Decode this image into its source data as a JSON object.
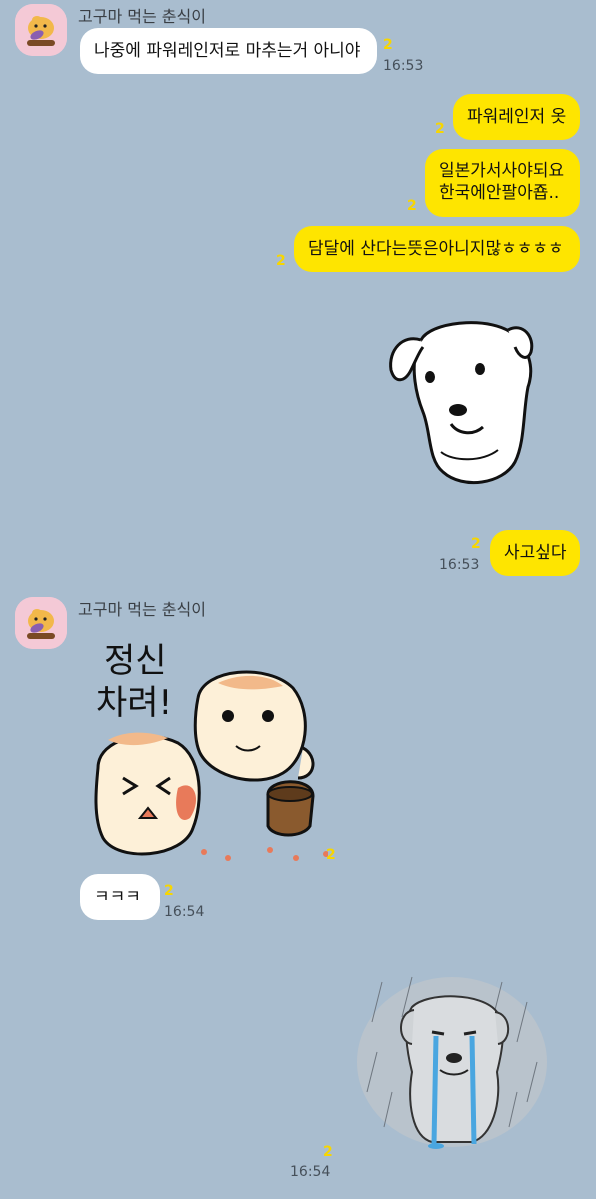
{
  "chat": {
    "sender_name": "고구마 먹는 춘식이",
    "messages": [
      {
        "id": "m1",
        "direction": "in",
        "text": "나중에 파워레인저로 마추는거 아니야",
        "unread": "2",
        "time": "16:53"
      },
      {
        "id": "m2",
        "direction": "out",
        "text": "파워레인저 옷",
        "unread": "2"
      },
      {
        "id": "m3",
        "direction": "out",
        "lines": [
          "일본가서사야되요",
          "한국에안팔아죱.."
        ],
        "unread": "2"
      },
      {
        "id": "m4",
        "direction": "out",
        "text": "담달에 산다는뜻은아니지많ㅎㅎㅎㅎ",
        "unread": "2"
      },
      {
        "id": "m5",
        "direction": "out",
        "type": "sticker",
        "sticker": "white-dog-sticker"
      },
      {
        "id": "m6",
        "direction": "out",
        "text": "사고싶다",
        "unread": "2",
        "time": "16:53"
      },
      {
        "id": "m7",
        "direction": "in",
        "type": "sticker",
        "sticker": "hamsters-sticker",
        "sticker_text": [
          "정신",
          "차려!"
        ],
        "unread": "2"
      },
      {
        "id": "m8",
        "direction": "in",
        "text": "ㅋㅋㅋ",
        "unread": "2",
        "time": "16:54"
      },
      {
        "id": "m9",
        "direction": "out",
        "type": "sticker",
        "sticker": "crying-dog-rain-sticker",
        "unread": "2",
        "time": "16:54"
      }
    ]
  },
  "colors": {
    "background": "#a9bdcf",
    "outgoing_bubble": "#fee500",
    "incoming_bubble": "#ffffff",
    "unread_count": "#f7d600",
    "avatar_bg": "#f4c9d6"
  }
}
